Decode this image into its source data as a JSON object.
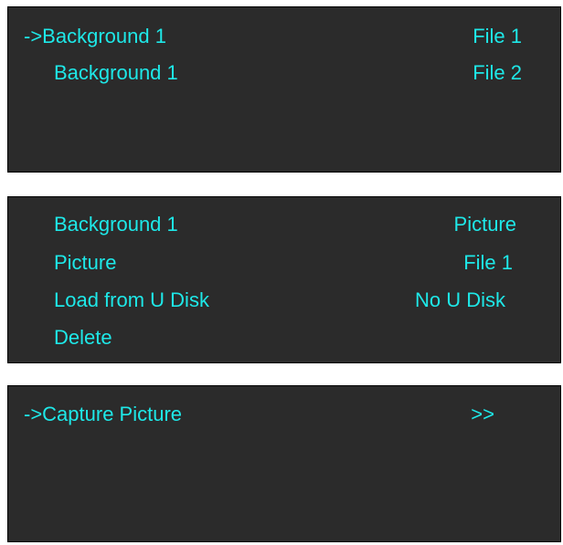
{
  "panel1": {
    "rows": [
      {
        "label": "->Background 1",
        "value": "File 1"
      },
      {
        "label": "Background 1",
        "value": "File 2"
      }
    ]
  },
  "panel2": {
    "rows": [
      {
        "label": "Background 1",
        "value": "Picture"
      },
      {
        "label": "Picture",
        "value": "File 1"
      },
      {
        "label": "Load from U Disk",
        "value": "No U Disk"
      },
      {
        "label": "Delete",
        "value": ""
      }
    ]
  },
  "panel3": {
    "rows": [
      {
        "label": "->Capture Picture",
        "value": ">>"
      }
    ]
  },
  "colors": {
    "panel_background": "#2b2b2b",
    "text": "#1ee8e8",
    "page_background": "#ffffff"
  }
}
